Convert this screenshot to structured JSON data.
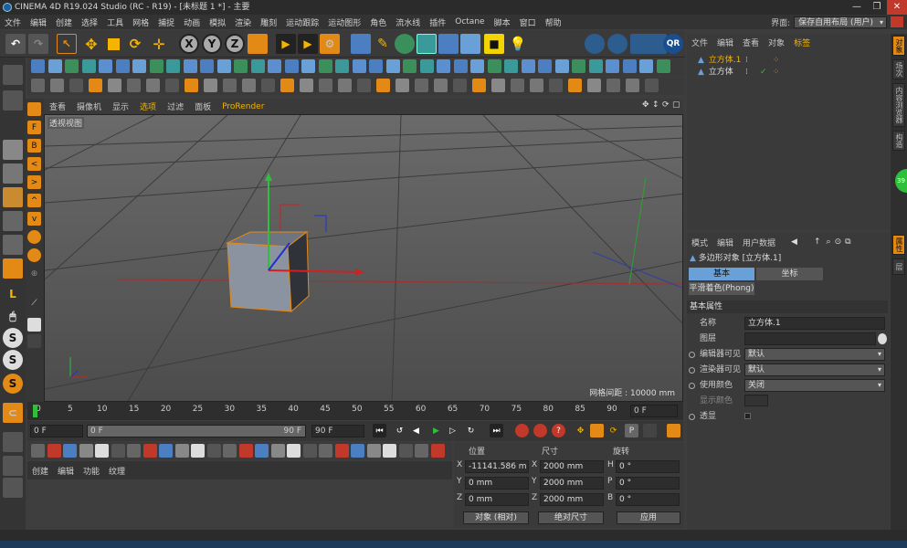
{
  "window": {
    "title": "CINEMA 4D R19.024 Studio (RC - R19) - [未标题 1 *] - 主要",
    "controls": [
      "—",
      "❐",
      "✕"
    ]
  },
  "menubar": {
    "items": [
      "文件",
      "编辑",
      "创建",
      "选择",
      "工具",
      "网格",
      "捕捉",
      "动画",
      "模拟",
      "渲染",
      "雕刻",
      "运动跟踪",
      "运动图形",
      "角色",
      "流水线",
      "插件",
      "Octane",
      "脚本",
      "窗口",
      "帮助"
    ],
    "layout_label": "界面:",
    "layout_value": "保存自用布局 (用户)"
  },
  "toolbar": {
    "axis_buttons": [
      "X",
      "Y",
      "Z"
    ]
  },
  "viewport": {
    "menu": [
      "查看",
      "摄像机",
      "显示",
      "选项",
      "过滤",
      "面板",
      "ProRender"
    ],
    "label": "透视视图",
    "grid_distance": "网格间距 : 10000 mm"
  },
  "timeline": {
    "ticks": [
      "0",
      "5",
      "10",
      "15",
      "20",
      "25",
      "30",
      "35",
      "40",
      "45",
      "50",
      "55",
      "60",
      "65",
      "70",
      "75",
      "80",
      "85",
      "90"
    ],
    "current_frame": "0 F",
    "start": "0 F",
    "range_start": "0 F",
    "range_end": "90 F",
    "end": "90 F"
  },
  "material": {
    "menu": [
      "创建",
      "编辑",
      "功能",
      "纹理"
    ]
  },
  "coordinates": {
    "headers": [
      "位置",
      "尺寸",
      "旋转"
    ],
    "rows": [
      {
        "axis": "X",
        "pos": "-11141.586 m",
        "size_axis": "X",
        "size": "2000 mm",
        "rot_axis": "H",
        "rot": "0 °"
      },
      {
        "axis": "Y",
        "pos": "0 mm",
        "size_axis": "Y",
        "size": "2000 mm",
        "rot_axis": "P",
        "rot": "0 °"
      },
      {
        "axis": "Z",
        "pos": "0 mm",
        "size_axis": "Z",
        "size": "2000 mm",
        "rot_axis": "B",
        "rot": "0 °"
      }
    ],
    "mode": "对象 (相对)",
    "size_mode": "绝对尺寸",
    "apply": "应用"
  },
  "object_manager": {
    "menu": [
      "文件",
      "编辑",
      "查看",
      "对象",
      "标签"
    ],
    "objects": [
      "立方体.1",
      "立方体"
    ]
  },
  "attribute_manager": {
    "menu": [
      "模式",
      "编辑",
      "用户数据"
    ],
    "object_title": "多边形对象 [立方体.1]",
    "tabs": [
      "基本",
      "坐标"
    ],
    "subtab": "平滑着色(Phong)",
    "section": "基本属性",
    "fields": [
      {
        "label": "名称",
        "value": "立方体.1"
      },
      {
        "label": "图层",
        "value": ""
      },
      {
        "label": "编辑器可见",
        "value": "默认"
      },
      {
        "label": "渲染器可见",
        "value": "默认"
      },
      {
        "label": "使用颜色",
        "value": "关闭"
      },
      {
        "label": "显示颜色",
        "value": ""
      },
      {
        "label": "透显",
        "value": ""
      }
    ]
  },
  "right_tabs": [
    "对象",
    "场次",
    "内容浏览器",
    "构造",
    "属性",
    "层"
  ],
  "badge": "39"
}
